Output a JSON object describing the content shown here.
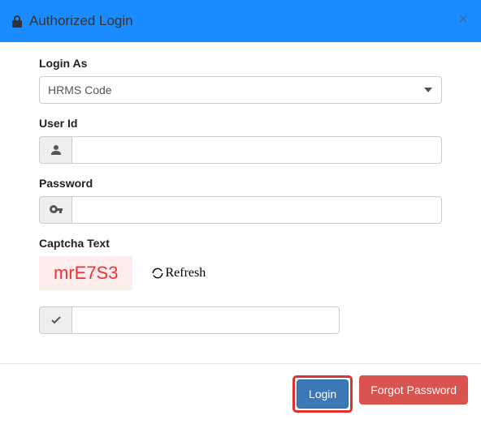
{
  "header": {
    "title": "Authorized Login"
  },
  "form": {
    "loginAs": {
      "label": "Login As",
      "selected": "HRMS Code"
    },
    "userId": {
      "label": "User Id",
      "value": ""
    },
    "password": {
      "label": "Password",
      "value": ""
    },
    "captcha": {
      "label": "Captcha Text",
      "value": "mrE7S3",
      "refreshLabel": "Refresh",
      "input": ""
    }
  },
  "footer": {
    "loginLabel": "Login",
    "forgotLabel": "Forgot Password"
  }
}
